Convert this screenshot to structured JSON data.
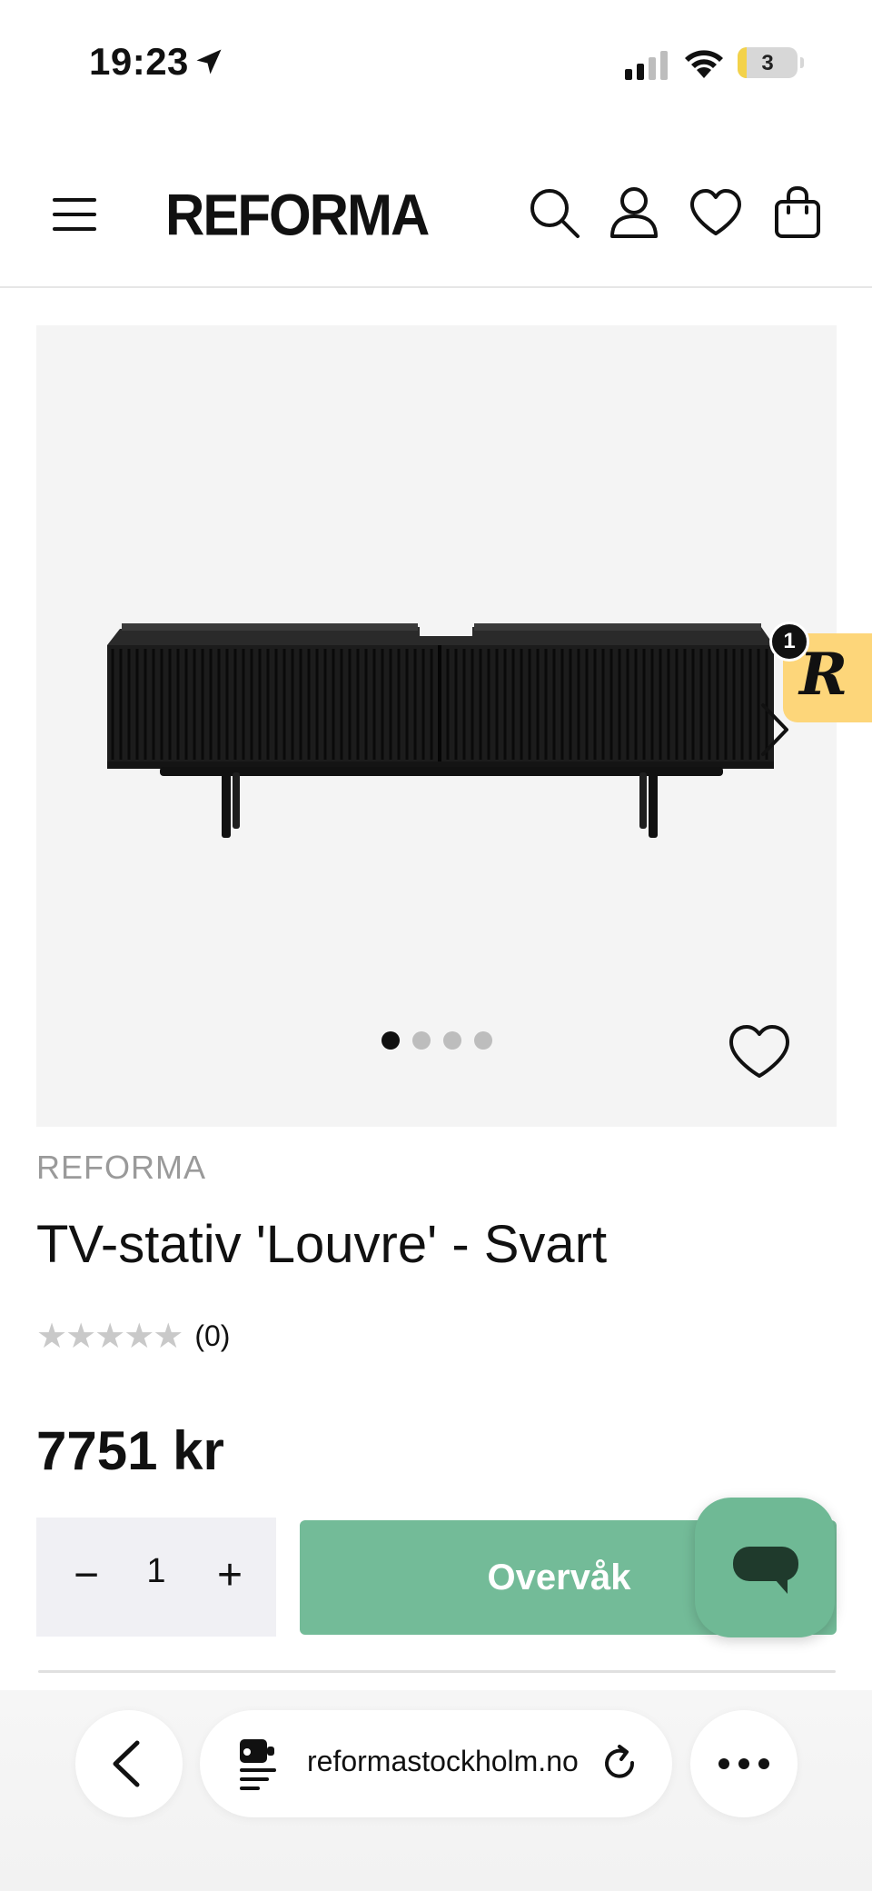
{
  "status": {
    "time": "19:23",
    "battery": "3"
  },
  "header": {
    "logo": "REFORMA",
    "icons": [
      "menu-icon",
      "search-icon",
      "account-icon",
      "wishlist-icon",
      "cart-icon"
    ]
  },
  "gallery": {
    "slide_count": 4,
    "active_slide": 1,
    "image_alt": "black fluted TV stand"
  },
  "rewards": {
    "badge_letter": "R",
    "count": "1",
    "color": "#fdd67a"
  },
  "product": {
    "brand": "REFORMA",
    "title": "TV-stativ 'Louvre' - Svart",
    "stars": "★★★★★",
    "review_count": "(0)",
    "price": "7751 kr"
  },
  "purchase": {
    "minus": "−",
    "quantity": "1",
    "plus": "+",
    "watch_label": "Overvåk",
    "accent": "#73bb98"
  },
  "browser": {
    "url": "reformastockholm.no"
  }
}
